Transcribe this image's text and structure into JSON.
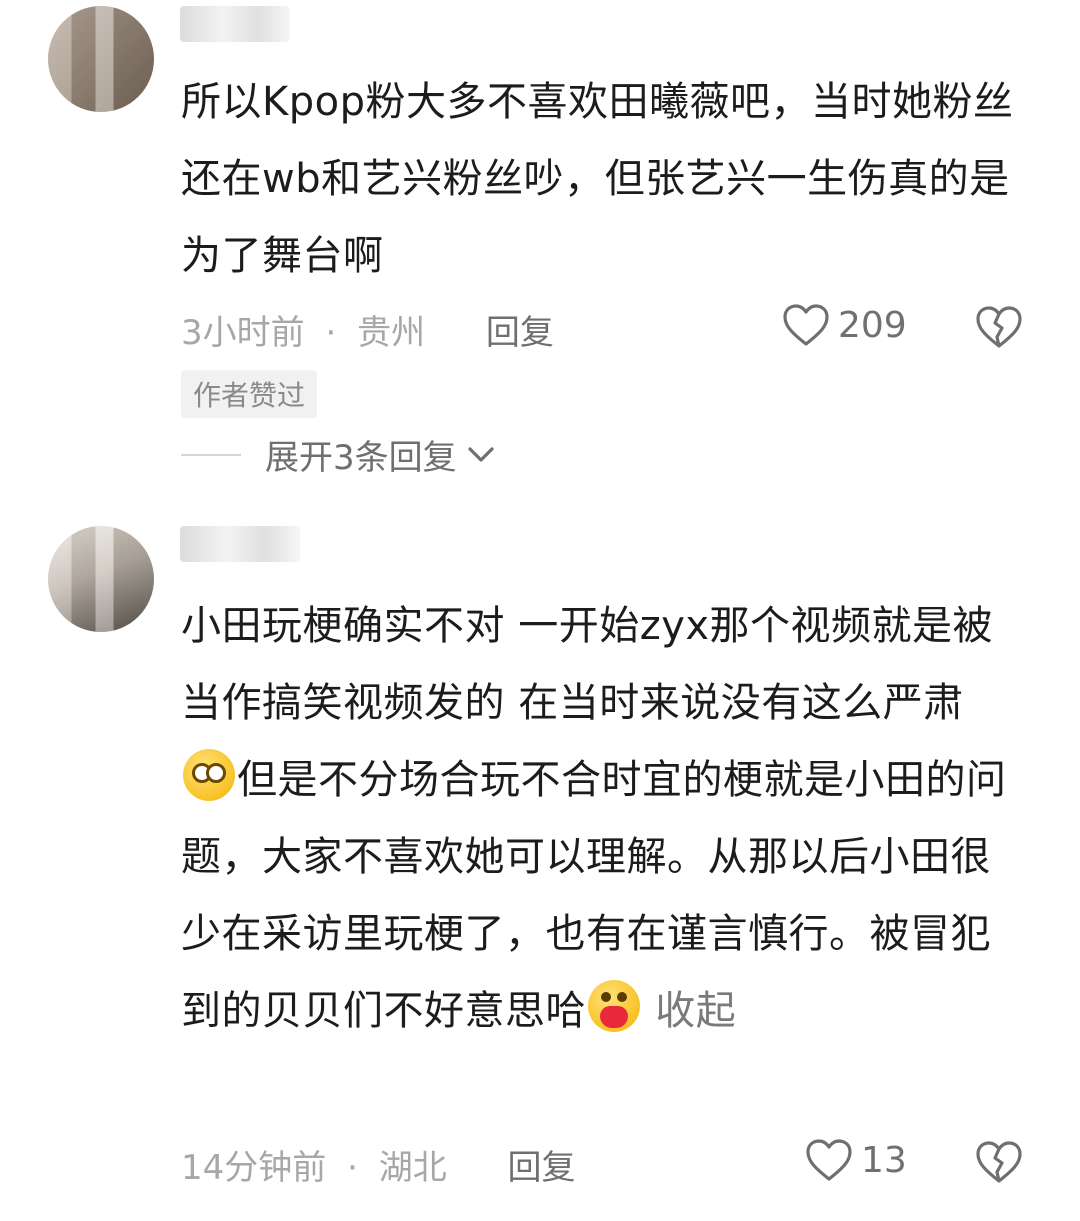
{
  "comments": [
    {
      "text": "所以Kpop粉大多不喜欢田曦薇吧，当时她粉丝还在wb和艺兴粉丝吵，但张艺兴一生伤真的是为了舞台啊",
      "time": "3小时前",
      "separator": "·",
      "location": "贵州",
      "reply_label": "回复",
      "likes": "209",
      "badge": "作者赞过",
      "expand_label": "展开3条回复"
    },
    {
      "text_part1": "小田玩梗确实不对  一开始zyx那个视频就是被当作搞笑视频发的 在当时来说没有这么严肃",
      "text_part2": "但是不分场合玩不合时宜的梗就是小田的问题，大家不喜欢她可以理解。从那以后小田很少在采访里玩梗了，也有在谨言慎行。被冒犯到的贝贝们不好意思哈",
      "collapse_label": "收起",
      "time": "14分钟前",
      "separator": "·",
      "location": "湖北",
      "reply_label": "回复",
      "likes": "13"
    }
  ],
  "icons": {
    "like": "heart-outline-icon",
    "dislike": "broken-heart-icon",
    "emoji1": "dazed-face-emoji",
    "emoji2": "face-holding-heart-emoji",
    "expand": "chevron-down-icon"
  },
  "colors": {
    "text": "#1c1c1c",
    "meta": "#a7a7a7",
    "secondary": "#6f6f6f"
  }
}
